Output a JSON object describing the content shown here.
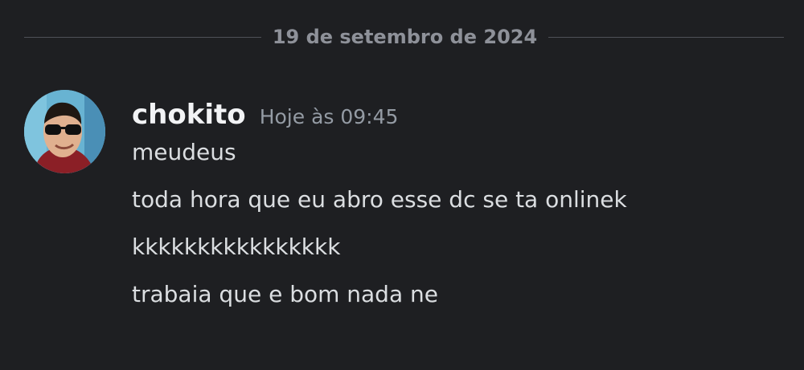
{
  "date_divider": "19 de setembro de 2024",
  "message": {
    "username": "chokito",
    "timestamp": "Hoje às 09:45",
    "avatar_icon": "user-avatar-photo",
    "lines": [
      "meudeus",
      "toda hora que eu abro esse dc se ta onlinek",
      "kkkkkkkkkkkkkkkk",
      "trabaia que e bom nada ne"
    ]
  },
  "colors": {
    "background": "#1e1f22",
    "username": "#f2f3f5",
    "timestamp": "#949ba4",
    "message_text": "#dbdee1",
    "divider": "#4e5058"
  }
}
